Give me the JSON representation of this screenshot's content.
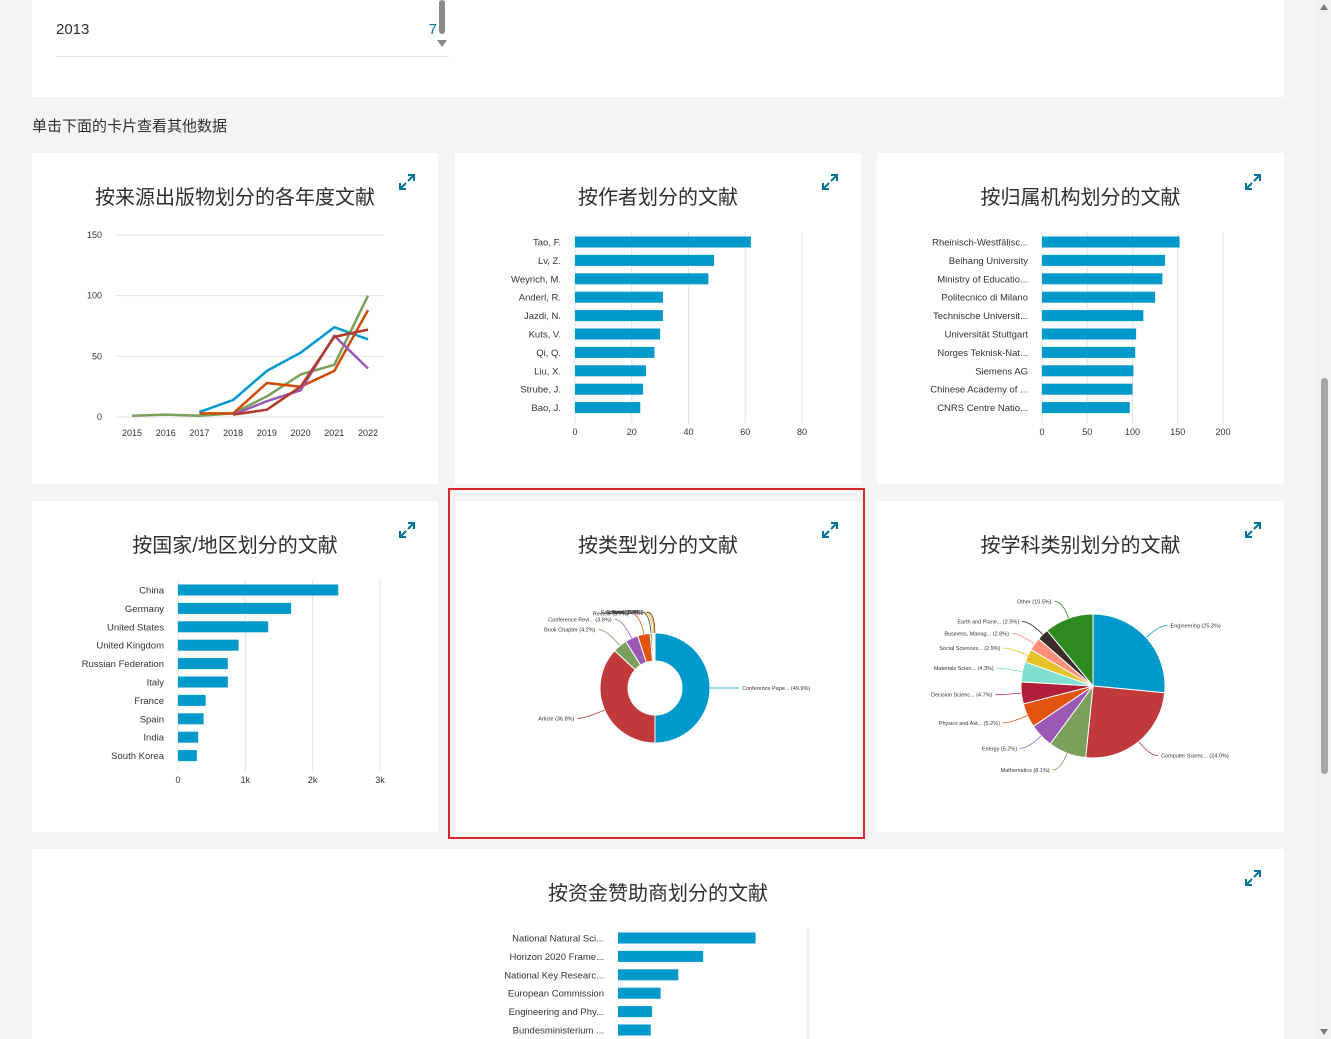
{
  "top_panel": {
    "year": "2013",
    "count": "7"
  },
  "hint": "单击下面的卡片查看其他数据",
  "icons": {
    "expand": "expand-icon"
  },
  "colors": {
    "accent": "#0099cc",
    "link": "#007398",
    "highlight": "#d9262c"
  },
  "charts": {
    "year_by_source": {
      "title": "按来源出版物划分的各年度文献",
      "chart_data": {
        "type": "line",
        "x": [
          "2015",
          "2016",
          "2017",
          "2018",
          "2019",
          "2020",
          "2021",
          "2022"
        ],
        "ylim": [
          0,
          150
        ],
        "yticks": [
          "0",
          "50",
          "100",
          "150"
        ],
        "series": [
          {
            "color": "#0099cc",
            "values": [
              null,
              null,
              4,
              14,
              38,
              53,
              74,
              64
            ]
          },
          {
            "color": "#7ba05b",
            "values": [
              1,
              2,
              1,
              3,
              17,
              35,
              43,
              100
            ]
          },
          {
            "color": "#d04a02",
            "values": [
              null,
              null,
              3,
              3,
              28,
              25,
              38,
              88
            ]
          },
          {
            "color": "#9b59b6",
            "values": [
              null,
              null,
              null,
              2,
              13,
              22,
              67,
              40
            ]
          },
          {
            "color": "#b03a2e",
            "values": [
              null,
              null,
              null,
              2,
              6,
              25,
              66,
              72
            ]
          }
        ]
      }
    },
    "by_author": {
      "title": "按作者划分的文献",
      "chart_data": {
        "type": "bar",
        "orientation": "horizontal",
        "categories": [
          "Tao, F.",
          "Lv, Z.",
          "Weyrich, M.",
          "Anderl, R.",
          "Jazdi, N.",
          "Kuts, V.",
          "Qi, Q.",
          "Liu, X.",
          "Strube, J.",
          "Bao, J."
        ],
        "values": [
          62,
          49,
          47,
          31,
          31,
          30,
          28,
          25,
          24,
          23
        ],
        "xlim": [
          0,
          80
        ],
        "xticks": [
          "0",
          "20",
          "40",
          "60",
          "80"
        ]
      }
    },
    "by_affiliation": {
      "title": "按归属机构划分的文献",
      "chart_data": {
        "type": "bar",
        "orientation": "horizontal",
        "categories": [
          "Rheinisch-Westfälisc...",
          "Beihang University",
          "Ministry of Educatio...",
          "Politecnico di Milano",
          "Technische Universit...",
          "Universität Stuttgart",
          "Norges Teknisk-Nat...",
          "Siemens AG",
          "Chinese Academy of ...",
          "CNRS Centre Natio..."
        ],
        "values": [
          152,
          136,
          133,
          125,
          112,
          104,
          103,
          101,
          100,
          97
        ],
        "xlim": [
          0,
          200
        ],
        "xticks": [
          "0",
          "50",
          "100",
          "150",
          "200"
        ]
      }
    },
    "by_country": {
      "title": "按国家/地区划分的文献",
      "chart_data": {
        "type": "bar",
        "orientation": "horizontal",
        "categories": [
          "China",
          "Germany",
          "United States",
          "United Kingdom",
          "Russian Federation",
          "Italy",
          "France",
          "Spain",
          "India",
          "South Korea"
        ],
        "values": [
          2380,
          1680,
          1340,
          900,
          740,
          740,
          410,
          380,
          300,
          280
        ],
        "xlim": [
          0,
          3000
        ],
        "xticks": [
          "0",
          "1k",
          "2k",
          "3k"
        ]
      }
    },
    "by_type": {
      "title": "按类型划分的文献",
      "chart_data": {
        "type": "pie",
        "donut": true,
        "labels": [
          "Conference Pape... (49.9%)",
          "Article (36.8%)",
          "Book Chapter (4.2%)",
          "Conference Revi... (3.8%)",
          "Review (3.7%)",
          "Editorial (0.5%)",
          "Note (0.4%)",
          "Book (0.4%)",
          "Erratum (0.1%)"
        ],
        "values": [
          49.9,
          36.8,
          4.2,
          3.8,
          3.7,
          0.5,
          0.4,
          0.4,
          0.1
        ],
        "colors": [
          "#0099cc",
          "#c0393b",
          "#7ba05b",
          "#9b59b6",
          "#e0540f",
          "#1b5e20",
          "#f4b183",
          "#e5c100",
          "#7f1d1d"
        ]
      }
    },
    "by_subject": {
      "title": "按学科类别划分的文献",
      "chart_data": {
        "type": "pie",
        "labels": [
          "Engineering (25.3%)",
          "Computer Scienc... (24.0%)",
          "Mathematics (8.1%)",
          "Energy (5.2%)",
          "Physics and Ast... (5.2%)",
          "Decision Scienc... (4.7%)",
          "Materials Scien... (4.3%)",
          "Social Sciences... (2.9%)",
          "Business, Manag... (2.8%)",
          "Earth and Plane... (2.5%)",
          "Other (10.5%)"
        ],
        "values": [
          25.3,
          24.0,
          8.1,
          5.2,
          5.2,
          4.7,
          4.3,
          2.9,
          2.8,
          2.5,
          10.5
        ],
        "colors": [
          "#0099cc",
          "#c0393b",
          "#7ba05b",
          "#9b59b6",
          "#e0540f",
          "#b01e3a",
          "#7ee0cf",
          "#e6c229",
          "#ff8e7a",
          "#3a2b2b",
          "#2e8b22"
        ]
      }
    },
    "by_funder": {
      "title": "按资金赞助商划分的文献",
      "chart_data": {
        "type": "bar",
        "orientation": "horizontal",
        "categories": [
          "National Natural Sci...",
          "Horizon 2020 Frame...",
          "National Key Researc...",
          "European Commission",
          "Engineering and Phy...",
          "Bundesministerium ..."
        ],
        "values": [
          210,
          130,
          92,
          65,
          52,
          50
        ],
        "xlim": [
          0,
          290
        ],
        "xticks": []
      }
    }
  }
}
